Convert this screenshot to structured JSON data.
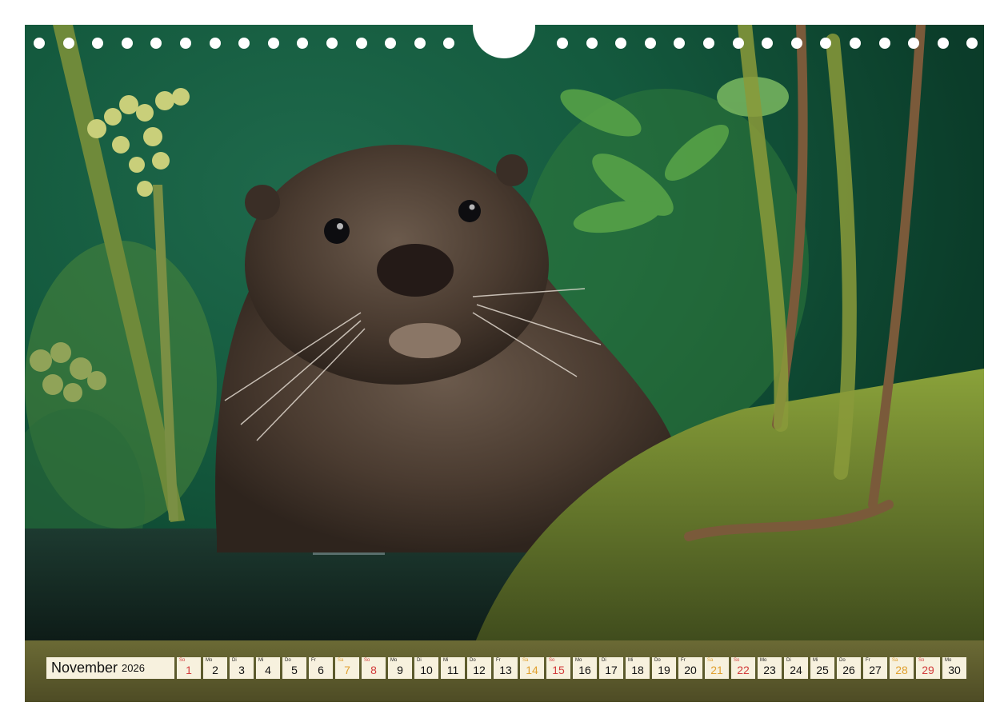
{
  "calendar": {
    "month": "November",
    "year": "2026",
    "days": [
      {
        "wd": "So",
        "n": "1",
        "kind": "sun"
      },
      {
        "wd": "Mo",
        "n": "2",
        "kind": "wk"
      },
      {
        "wd": "Di",
        "n": "3",
        "kind": "wk"
      },
      {
        "wd": "Mi",
        "n": "4",
        "kind": "wk"
      },
      {
        "wd": "Do",
        "n": "5",
        "kind": "wk"
      },
      {
        "wd": "Fr",
        "n": "6",
        "kind": "wk"
      },
      {
        "wd": "Sa",
        "n": "7",
        "kind": "sat"
      },
      {
        "wd": "So",
        "n": "8",
        "kind": "sun"
      },
      {
        "wd": "Mo",
        "n": "9",
        "kind": "wk"
      },
      {
        "wd": "Di",
        "n": "10",
        "kind": "wk"
      },
      {
        "wd": "Mi",
        "n": "11",
        "kind": "wk"
      },
      {
        "wd": "Do",
        "n": "12",
        "kind": "wk"
      },
      {
        "wd": "Fr",
        "n": "13",
        "kind": "wk"
      },
      {
        "wd": "Sa",
        "n": "14",
        "kind": "sat"
      },
      {
        "wd": "So",
        "n": "15",
        "kind": "sun"
      },
      {
        "wd": "Mo",
        "n": "16",
        "kind": "wk"
      },
      {
        "wd": "Di",
        "n": "17",
        "kind": "wk"
      },
      {
        "wd": "Mi",
        "n": "18",
        "kind": "wk"
      },
      {
        "wd": "Do",
        "n": "19",
        "kind": "wk"
      },
      {
        "wd": "Fr",
        "n": "20",
        "kind": "wk"
      },
      {
        "wd": "Sa",
        "n": "21",
        "kind": "sat"
      },
      {
        "wd": "So",
        "n": "22",
        "kind": "sun"
      },
      {
        "wd": "Mo",
        "n": "23",
        "kind": "wk"
      },
      {
        "wd": "Di",
        "n": "24",
        "kind": "wk"
      },
      {
        "wd": "Mi",
        "n": "25",
        "kind": "wk"
      },
      {
        "wd": "Do",
        "n": "26",
        "kind": "wk"
      },
      {
        "wd": "Fr",
        "n": "27",
        "kind": "wk"
      },
      {
        "wd": "Sa",
        "n": "28",
        "kind": "sat"
      },
      {
        "wd": "So",
        "n": "29",
        "kind": "sun"
      },
      {
        "wd": "Mo",
        "n": "30",
        "kind": "wk"
      }
    ]
  },
  "colors": {
    "saturday": "#e0a030",
    "sunday": "#d23b3b",
    "cell_bg": "#f7f1de"
  },
  "photo": {
    "subject": "otter-icon"
  }
}
